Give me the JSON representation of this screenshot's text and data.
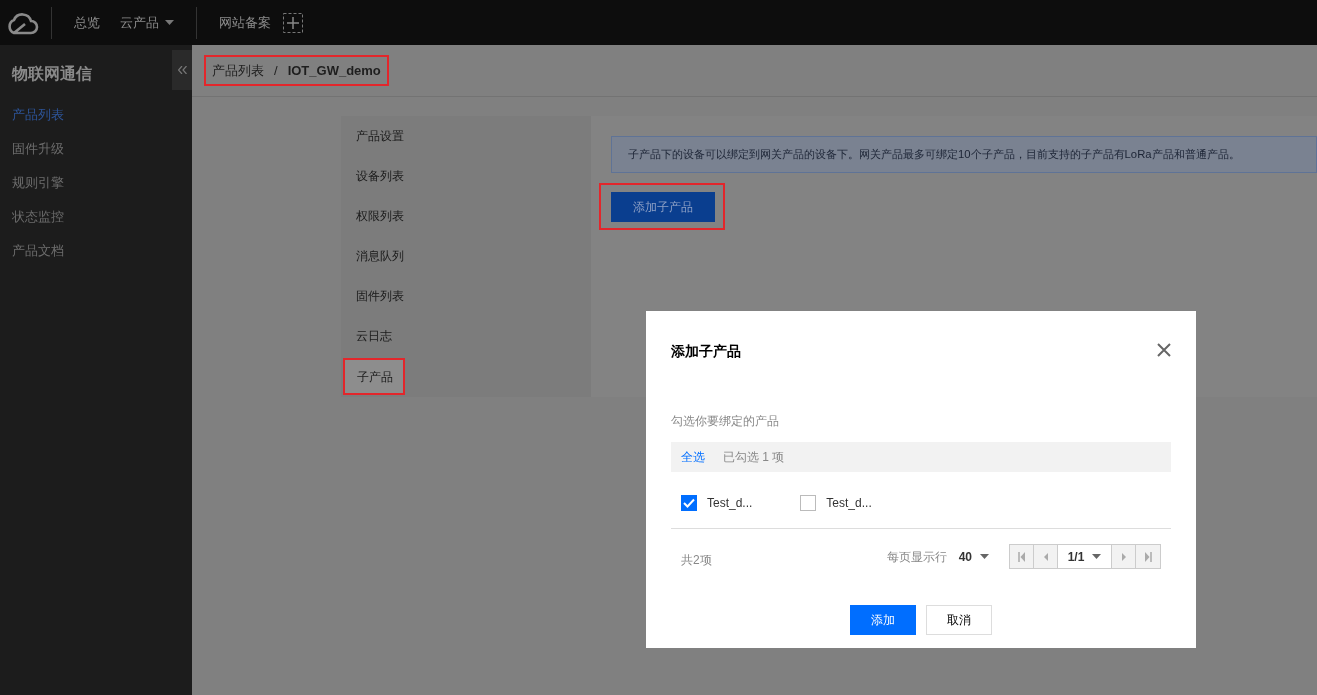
{
  "top_nav": {
    "groups": [
      [
        {
          "label": "总览",
          "dropdown": false
        },
        {
          "label": "云产品",
          "dropdown": true
        }
      ],
      [
        {
          "label": "网站备案",
          "dropdown": false
        }
      ]
    ]
  },
  "sidebar": {
    "title": "物联网通信",
    "items": [
      {
        "label": "产品列表",
        "selected": true
      },
      {
        "label": "固件升级",
        "selected": false
      },
      {
        "label": "规则引擎",
        "selected": false
      },
      {
        "label": "状态监控",
        "selected": false
      },
      {
        "label": "产品文档",
        "selected": false
      }
    ]
  },
  "breadcrumb": {
    "items": [
      "产品列表",
      "IOT_GW_demo"
    ],
    "separator": "/",
    "highlighted": true
  },
  "tabs": [
    {
      "label": "产品设置",
      "selected": false,
      "highlighted": false
    },
    {
      "label": "设备列表",
      "selected": false,
      "highlighted": false
    },
    {
      "label": "权限列表",
      "selected": false,
      "highlighted": false
    },
    {
      "label": "消息队列",
      "selected": false,
      "highlighted": false
    },
    {
      "label": "固件列表",
      "selected": false,
      "highlighted": false
    },
    {
      "label": "云日志",
      "selected": false,
      "highlighted": false
    },
    {
      "label": "子产品",
      "selected": true,
      "highlighted": true
    }
  ],
  "notice": "子产品下的设备可以绑定到网关产品的设备下。网关产品最多可绑定10个子产品，目前支持的子产品有LoRa产品和普通产品。",
  "add_button": {
    "label": "添加子产品",
    "highlighted": true
  },
  "modal": {
    "title": "添加子产品",
    "instruction": "勾选你要绑定的产品",
    "select_all": "全选",
    "selected_count": "已勾选 1 项",
    "options": [
      {
        "label": "Test_d...",
        "checked": true
      },
      {
        "label": "Test_d...",
        "checked": false
      }
    ],
    "total": "共2项",
    "page_size_label": "每页显示行",
    "page_size": "40",
    "page": "1/1",
    "buttons": [
      {
        "label": "添加",
        "kind": "primary"
      },
      {
        "label": "取消",
        "kind": "secondary"
      }
    ]
  }
}
